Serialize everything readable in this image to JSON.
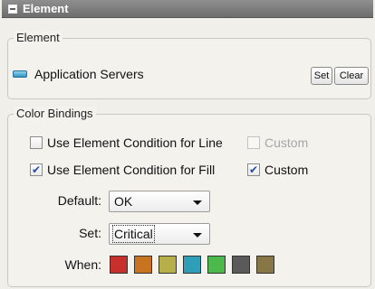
{
  "panel": {
    "title": "Element"
  },
  "element_group": {
    "legend": "Element",
    "element_name": "Application Servers",
    "set_label": "Set",
    "clear_label": "Clear"
  },
  "color_bindings": {
    "legend": "Color Bindings",
    "line": {
      "label": "Use Element Condition for Line",
      "checked": false,
      "custom_label": "Custom",
      "custom_checked": false,
      "custom_enabled": false
    },
    "fill": {
      "label": "Use Element Condition for Fill",
      "checked": true,
      "custom_label": "Custom",
      "custom_checked": true,
      "custom_enabled": true
    },
    "default": {
      "label": "Default:",
      "value": "OK"
    },
    "set": {
      "label": "Set:",
      "value": "Critical"
    },
    "when": {
      "label": "When:"
    },
    "swatch_colors": [
      "#c8312b",
      "#c8731f",
      "#b7b04a",
      "#2f9fb8",
      "#4cb94c",
      "#5a5a5a",
      "#877646"
    ]
  },
  "icons": {
    "collapse": "collapse-minus-icon",
    "element": "server-icon",
    "dropdown": "chevron-down-icon",
    "check": "checkmark-icon"
  }
}
